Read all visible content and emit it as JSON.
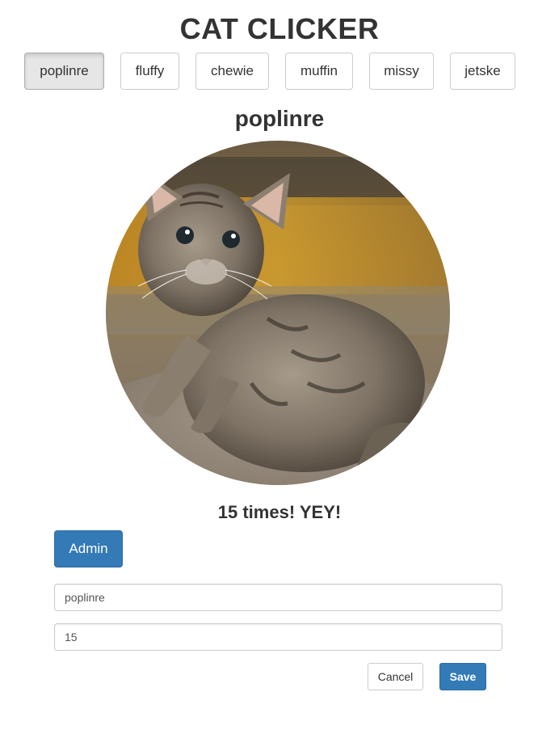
{
  "app": {
    "title": "CAT CLICKER"
  },
  "cat_list": [
    {
      "label": "poplinre",
      "active": true
    },
    {
      "label": "fluffy",
      "active": false
    },
    {
      "label": "chewie",
      "active": false
    },
    {
      "label": "muffin",
      "active": false
    },
    {
      "label": "missy",
      "active": false
    },
    {
      "label": "jetske",
      "active": false
    }
  ],
  "current_cat": {
    "name": "poplinre",
    "image_icon": "kitten-photo",
    "click_message": "15 times! YEY!"
  },
  "admin": {
    "button_label": "Admin",
    "name_value": "poplinre",
    "clicks_value": "15",
    "cancel_label": "Cancel",
    "save_label": "Save"
  },
  "colors": {
    "primary": "#337ab7",
    "text": "#333333",
    "active_button_bg": "#e6e6e6"
  }
}
